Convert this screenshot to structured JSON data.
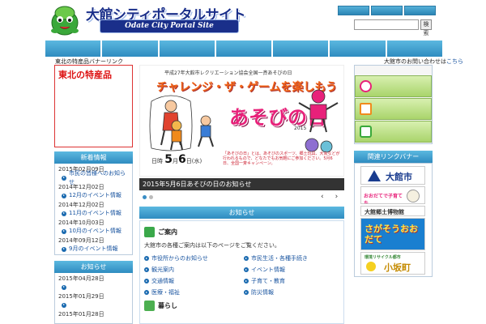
{
  "header": {
    "logo_jp": "大館シティポータルサイト",
    "logo_en": "Odate City Portal Site",
    "search_button": "検索"
  },
  "nav": {
    "items": [
      "",
      "",
      "",
      "",
      "",
      "",
      ""
    ]
  },
  "left": {
    "top_text": "東北の特産品バナーリンク",
    "tohoku_title": "東北の特産品",
    "section1": {
      "title": "新着情報",
      "entries": [
        {
          "date": "2015年02月09日",
          "link": "市民の皆様へのお知らせ"
        },
        {
          "date": "2014年12月02日",
          "link": "12月のイベント情報"
        },
        {
          "date": "2014年12月02日",
          "link": "11月のイベント情報"
        },
        {
          "date": "2014年10月03日",
          "link": "10月のイベント情報"
        },
        {
          "date": "2014年09月12日",
          "link": "9月のイベント情報"
        }
      ]
    },
    "section2": {
      "title": "お知らせ",
      "entries": [
        {
          "date": "2015年04月28日",
          "link": ""
        },
        {
          "date": "2015年01月29日",
          "link": ""
        },
        {
          "date": "2015年01月28日",
          "link": ""
        }
      ]
    }
  },
  "banner": {
    "caption_top": "平成27年大館市レクリエーション協会全国一斉あそびの日",
    "title1": "チャレンジ・ザ・ゲームを楽しもう",
    "title2": "あそびの日",
    "year": "2015",
    "date_prefix": "日時",
    "month": "5",
    "month_unit": "月",
    "day": "6",
    "weekday": "日(水)",
    "description": "「あそびの日」とは、あそびのスポーツ、郷土玩具、大会などが行われるもので、どなたでもお気軽にご参加ください。5月6日、全国一斉キャンペーン。"
  },
  "slider": {
    "caption": "2015年5月6日あそびの日のお知らせ",
    "prev": "‹",
    "next": "›"
  },
  "notice": {
    "title": "お知らせ",
    "section_a": {
      "heading": "ご案内",
      "description": "大館市の各種ご案内は以下のページをご覧ください。",
      "links": [
        "市役所からのお知らせ",
        "市民生活・各種手続き",
        "観光案内",
        "イベント情報",
        "交通情報",
        "子育て・教育",
        "医療・福祉",
        "防災情報"
      ]
    },
    "section_b": {
      "heading": "暮らし"
    }
  },
  "right": {
    "top_text_prefix": "大館市のお問い合わせは",
    "top_text_link": "こちら",
    "links_title": "関連リンクバナー",
    "banners": {
      "b1": "大館市",
      "b2": "おおだてで子育てを",
      "b3": "大館郷土博物館",
      "b4": "さがそうおおだて",
      "b5_title": "環境リサイクル都市",
      "b5_main": "小坂町"
    }
  },
  "colors": {
    "nav_blue": "#2f8cc0",
    "banner_orange": "#f06418",
    "banner_pink": "#e8217a",
    "tohoku_red": "#dd1111",
    "green_button": "#a9d46b"
  },
  "icons": [
    "mascot-icon",
    "star-icon",
    "book-icon",
    "screen-icon",
    "chevron-right-icon",
    "recycle-icon",
    "leaf-icon"
  ]
}
